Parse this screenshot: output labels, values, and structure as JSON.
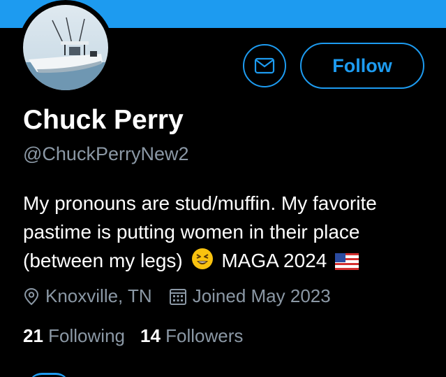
{
  "header": {
    "banner_color": "#1d9bf0"
  },
  "profile": {
    "avatar_icon": "boat-photo",
    "name": "Chuck Perry",
    "handle": "@ChuckPerryNew2",
    "bio_lines": [
      "My pronouns are stud/muffin. My favorite",
      "pastime is putting women in their place",
      "(between my legs)"
    ],
    "bio_tail": "MAGA 2024",
    "bio_emojis": [
      "grinning-squinting-face-emoji",
      "us-flag-emoji"
    ],
    "location": "Knoxville, TN",
    "joined": "Joined May 2023",
    "following_count": "21",
    "following_label": "Following",
    "followers_count": "14",
    "followers_label": "Followers"
  },
  "actions": {
    "message_icon": "envelope-icon",
    "follow_label": "Follow"
  },
  "colors": {
    "accent": "#1d9bf0",
    "secondary_text": "#8b98a5",
    "background": "#000000"
  }
}
